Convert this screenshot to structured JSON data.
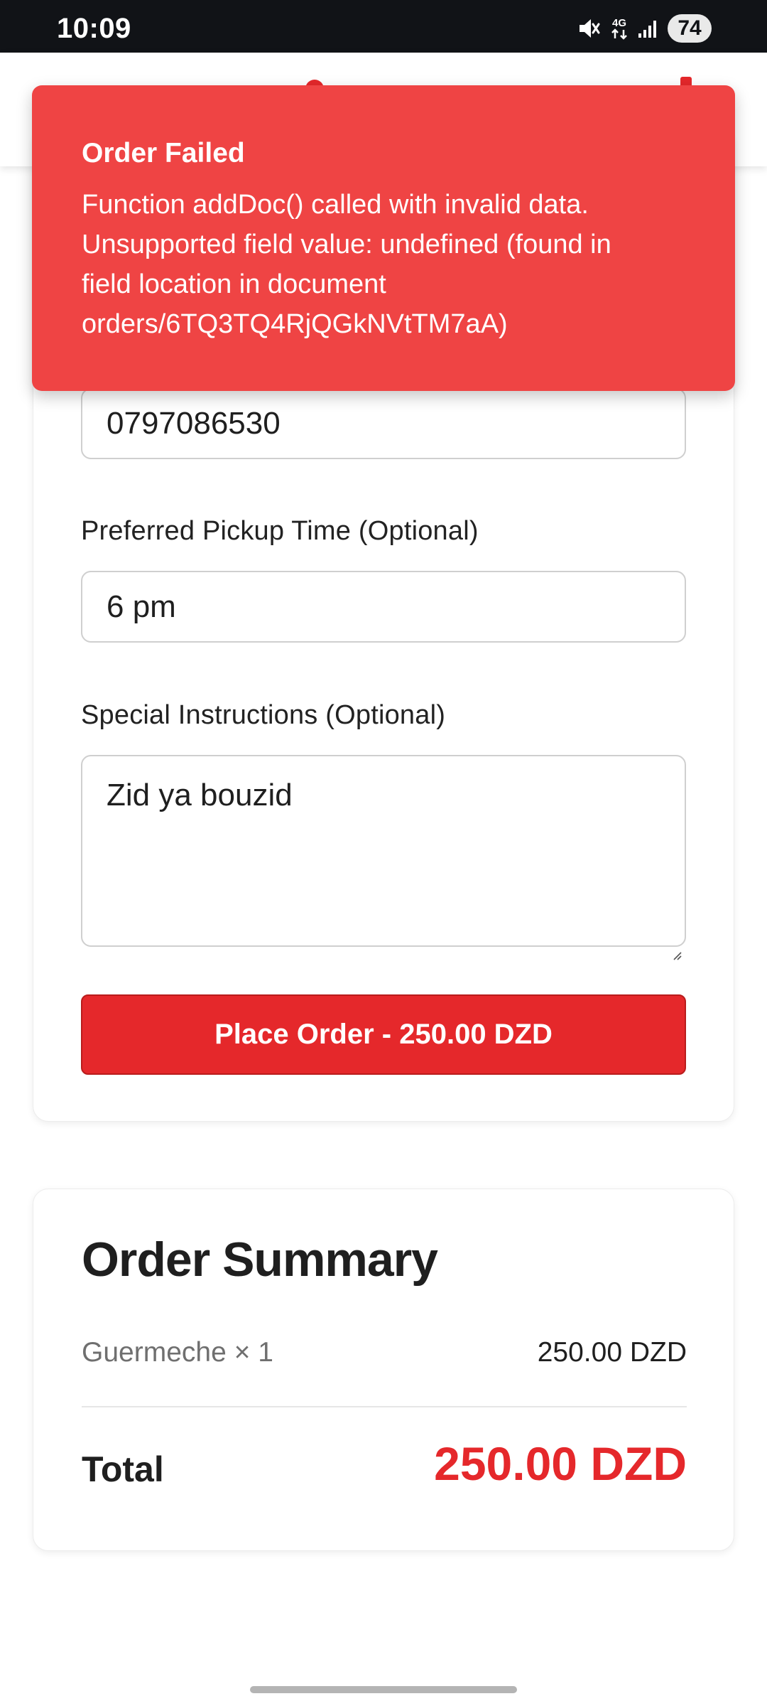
{
  "status_bar": {
    "time": "10:09",
    "network": "4G",
    "battery": "74",
    "icons": [
      "mute-icon",
      "4g-icon",
      "signal-icon",
      "battery-icon"
    ]
  },
  "toast": {
    "title": "Order Failed",
    "message": "Function addDoc() called with invalid data. Unsupported field value: undefined (found in field location in document orders/6TQ3TQ4RjQGkNVtTM7aA)",
    "background_color": "#ef4444"
  },
  "form": {
    "phone_value": "0797086530",
    "pickup_time_label": "Preferred Pickup Time (Optional)",
    "pickup_time_value": "6 pm",
    "instructions_label": "Special Instructions (Optional)",
    "instructions_value": "Zid ya bouzid",
    "place_order_label": "Place Order - 250.00 DZD"
  },
  "summary": {
    "title": "Order Summary",
    "items": [
      {
        "name": "Guermeche × 1",
        "price": "250.00 DZD"
      }
    ],
    "total_label": "Total",
    "total_value": "250.00 DZD"
  },
  "colors": {
    "accent": "#e5282b",
    "status_bar": "#111317"
  }
}
